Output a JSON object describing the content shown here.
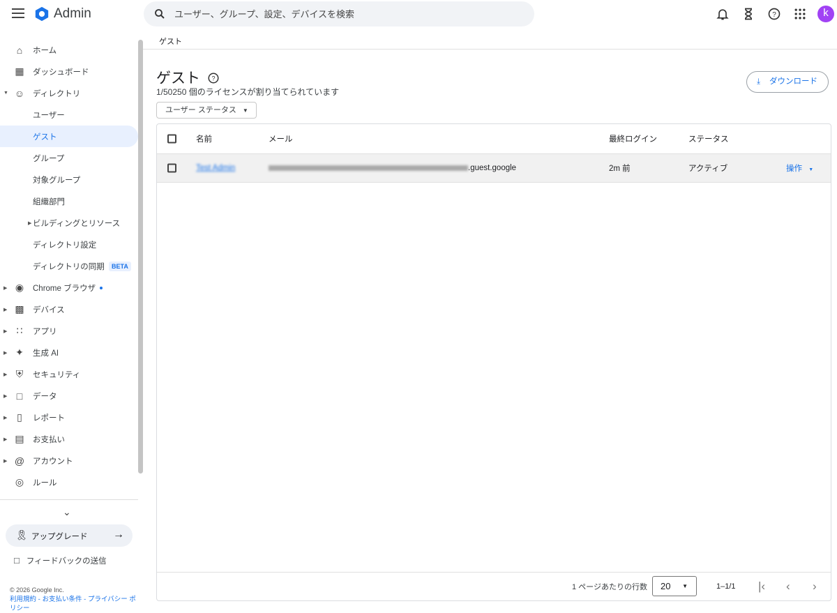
{
  "header": {
    "brand": "Admin",
    "search_placeholder": "ユーザー、グループ、設定、デバイスを検索",
    "avatar_letter": "k"
  },
  "sidebar": {
    "items": [
      {
        "label": "ホーム",
        "icon": "home-icon"
      },
      {
        "label": "ダッシュボード",
        "icon": "dashboard-icon"
      },
      {
        "label": "ディレクトリ",
        "icon": "person-icon",
        "expanded": true
      },
      {
        "label": "ユーザー",
        "sub": true
      },
      {
        "label": "ゲスト",
        "sub": true,
        "selected": true
      },
      {
        "label": "グループ",
        "sub": true
      },
      {
        "label": "対象グループ",
        "sub": true
      },
      {
        "label": "組織部門",
        "sub": true
      },
      {
        "label": "ビルディングとリソース",
        "sub": true,
        "collapsed": true
      },
      {
        "label": "ディレクトリ設定",
        "sub": true
      },
      {
        "label": "ディレクトリの同期",
        "sub": true,
        "badge": "BETA"
      },
      {
        "label": "Chrome ブラウザ",
        "icon": "chrome-icon",
        "dot": true
      },
      {
        "label": "デバイス",
        "icon": "devices-icon"
      },
      {
        "label": "アプリ",
        "icon": "apps-icon"
      },
      {
        "label": "生成 AI",
        "icon": "sparkle-icon"
      },
      {
        "label": "セキュリティ",
        "icon": "shield-icon"
      },
      {
        "label": "データ",
        "icon": "folder-icon"
      },
      {
        "label": "レポート",
        "icon": "bar-chart-icon"
      },
      {
        "label": "お支払い",
        "icon": "credit-card-icon"
      },
      {
        "label": "アカウント",
        "icon": "at-icon"
      },
      {
        "label": "ルール",
        "icon": "rule-icon"
      }
    ],
    "upgrade": "アップグレード",
    "feedback": "フィードバックの送信",
    "copyright": "© 2026 Google Inc.",
    "links": [
      "利用規約",
      "お支払い条件",
      "プライバシー ポリシー"
    ]
  },
  "breadcrumb": "ゲスト",
  "page": {
    "title": "ゲスト",
    "subtitle": "1/50250 個のライセンスが割り当てられています",
    "filter": "ユーザー ステータス",
    "download": "ダウンロード"
  },
  "table": {
    "columns": [
      "名前",
      "メール",
      "最終ログイン",
      "ステータス"
    ],
    "rows": [
      {
        "name": "Test Admin",
        "email_suffix": ".guest.google",
        "last_login": "2m 前",
        "status": "アクティブ",
        "action": "操作"
      }
    ],
    "rows_per_page_label": "1 ページあたりの行数",
    "rows_per_page": "20",
    "range": "1–1/1"
  },
  "colors": {
    "accent": "#1a73e8",
    "selected_bg": "#e8f0fe",
    "avatar": "#a142f4"
  }
}
